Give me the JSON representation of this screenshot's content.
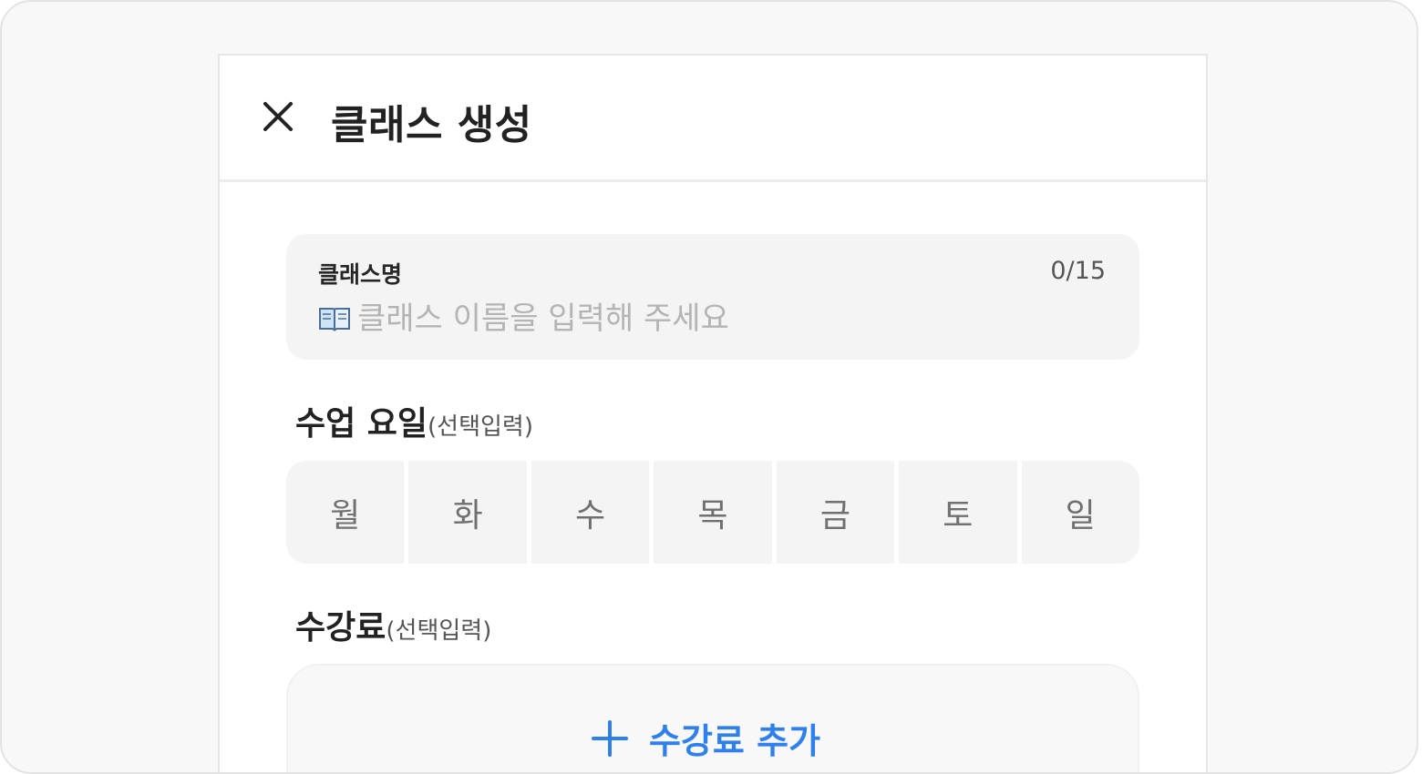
{
  "header": {
    "close_icon": "close-icon",
    "title": "클래스 생성"
  },
  "class_name": {
    "label": "클래스명",
    "counter": "0/15",
    "icon": "book-icon",
    "placeholder": "클래스 이름을 입력해 주세요",
    "value": ""
  },
  "days": {
    "title": "수업 요일",
    "optional": "(선택입력)",
    "items": [
      {
        "label": "월"
      },
      {
        "label": "화"
      },
      {
        "label": "수"
      },
      {
        "label": "목"
      },
      {
        "label": "금"
      },
      {
        "label": "토"
      },
      {
        "label": "일"
      }
    ]
  },
  "fee": {
    "title": "수강료",
    "optional": "(선택입력)",
    "add_icon": "plus-icon",
    "add_label": "수강료 추가"
  },
  "colors": {
    "accent": "#2f80ed",
    "field_bg": "#f4f4f4",
    "text_primary": "#222222"
  }
}
